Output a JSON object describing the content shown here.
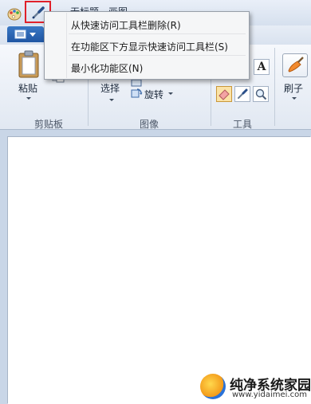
{
  "window": {
    "title": "无标题 - 画图"
  },
  "quick_access_menu": {
    "items": [
      {
        "label": "从快速访问工具栏删除(R)"
      },
      {
        "label": "在功能区下方显示快速访问工具栏(S)"
      },
      {
        "label": "最小化功能区(N)"
      }
    ]
  },
  "ribbon": {
    "clipboard": {
      "paste_label": "粘贴",
      "group_label": "剪贴板"
    },
    "image": {
      "select_label": "选择",
      "rotate_label": "旋转",
      "group_label": "图像"
    },
    "tools": {
      "group_label": "工具",
      "text_tool_glyph": "A"
    },
    "brushes": {
      "label": "刷子"
    }
  },
  "watermark": {
    "text": "纯净系统家园",
    "url": "www.yidaimei.com"
  },
  "colors": {
    "highlight": "#e0202a",
    "file_button": "#2a63b0",
    "canvas": "#ffffff",
    "workspace": "#c9d6e7"
  }
}
